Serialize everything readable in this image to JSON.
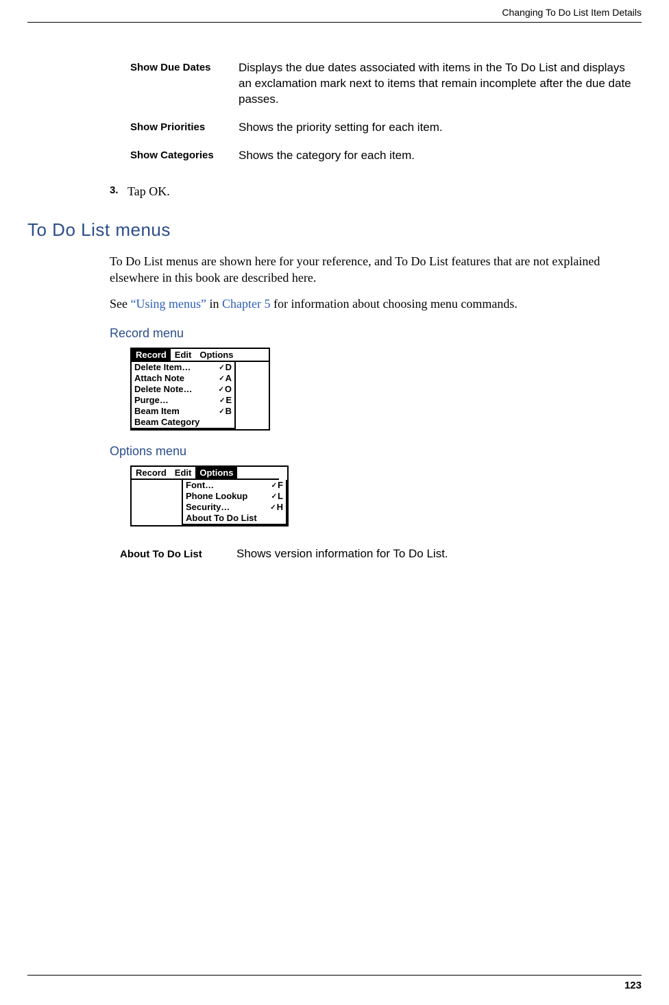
{
  "header": {
    "running_title": "Changing To Do List Item Details"
  },
  "definitions": [
    {
      "term": "Show Due Dates",
      "desc": "Displays the due dates associated with items in the To Do List and displays an exclamation mark next to items that remain incomplete after the due date passes."
    },
    {
      "term": "Show Priorities",
      "desc": "Shows the priority setting for each item."
    },
    {
      "term": "Show Categories",
      "desc": "Shows the category for each item."
    }
  ],
  "step": {
    "number": "3.",
    "text": "Tap OK."
  },
  "section": {
    "title": "To Do List menus",
    "para1": "To Do List menus are shown here for your reference, and To Do List features that are not explained elsewhere in this book are described here.",
    "para2_pre": "See ",
    "para2_link1": "“Using menus”",
    "para2_mid": " in ",
    "para2_link2": "Chapter 5",
    "para2_post": " for information about choosing menu commands."
  },
  "record_menu": {
    "heading": "Record menu",
    "tabs": [
      "Record",
      "Edit",
      "Options"
    ],
    "active_tab_index": 0,
    "items": [
      {
        "label": "Delete Item…",
        "shortcut": "D"
      },
      {
        "label": "Attach Note",
        "shortcut": "A"
      },
      {
        "label": "Delete Note…",
        "shortcut": "O"
      },
      {
        "label": "Purge…",
        "shortcut": "E"
      },
      {
        "label": "Beam Item",
        "shortcut": "B"
      },
      {
        "label": "Beam Category",
        "shortcut": ""
      }
    ]
  },
  "options_menu": {
    "heading": "Options menu",
    "tabs": [
      "Record",
      "Edit",
      "Options"
    ],
    "active_tab_index": 2,
    "items": [
      {
        "label": "Font…",
        "shortcut": "F"
      },
      {
        "label": "Phone Lookup",
        "shortcut": "L"
      },
      {
        "label": "Security…",
        "shortcut": "H"
      },
      {
        "label": "About To Do List",
        "shortcut": ""
      }
    ]
  },
  "about": {
    "term": "About To Do List",
    "desc": "Shows version information for To Do List."
  },
  "footer": {
    "page_number": "123"
  }
}
